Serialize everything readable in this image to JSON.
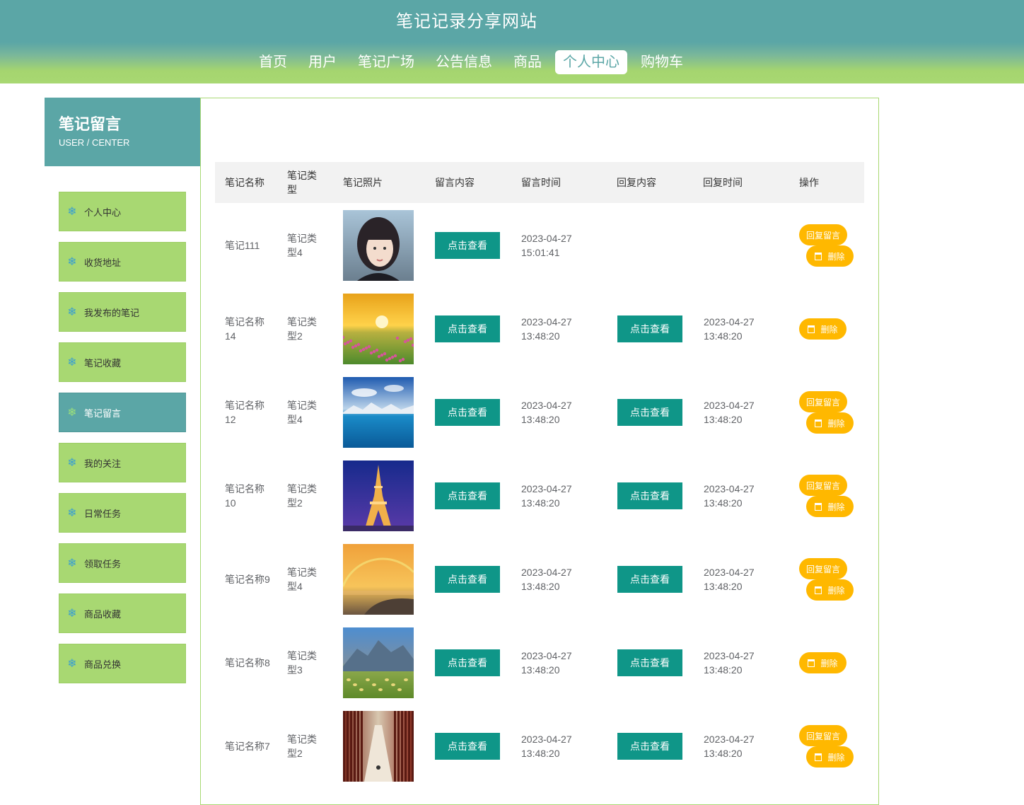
{
  "site": {
    "title": "笔记记录分享网站"
  },
  "nav": [
    {
      "label": "首页",
      "active": false
    },
    {
      "label": "用户",
      "active": false
    },
    {
      "label": "笔记广场",
      "active": false
    },
    {
      "label": "公告信息",
      "active": false
    },
    {
      "label": "商品",
      "active": false
    },
    {
      "label": "个人中心",
      "active": true
    },
    {
      "label": "购物车",
      "active": false
    }
  ],
  "sidebar": {
    "title": "笔记留言",
    "subtitle": "USER / CENTER",
    "icon": "snowflake-icon",
    "items": [
      {
        "label": "个人中心",
        "active": false
      },
      {
        "label": "收货地址",
        "active": false
      },
      {
        "label": "我发布的笔记",
        "active": false
      },
      {
        "label": "笔记收藏",
        "active": false
      },
      {
        "label": "笔记留言",
        "active": true
      },
      {
        "label": "我的关注",
        "active": false
      },
      {
        "label": "日常任务",
        "active": false
      },
      {
        "label": "领取任务",
        "active": false
      },
      {
        "label": "商品收藏",
        "active": false
      },
      {
        "label": "商品兑换",
        "active": false
      }
    ]
  },
  "table": {
    "headers": [
      "笔记名称",
      "笔记类型",
      "笔记照片",
      "留言内容",
      "留言时间",
      "回复内容",
      "回复时间",
      "操作"
    ],
    "view_label": "点击查看",
    "reply_label": "回复留言",
    "delete_label": "删除",
    "rows": [
      {
        "name": "笔记111",
        "type": "笔记类型4",
        "photo": "portrait",
        "msg_time": "2023-04-27 15:01:41",
        "has_reply": false,
        "reply_time": "",
        "can_reply": true
      },
      {
        "name": "笔记名称14",
        "type": "笔记类型2",
        "photo": "sunset-flowers",
        "msg_time": "2023-04-27 13:48:20",
        "has_reply": true,
        "reply_time": "2023-04-27 13:48:20",
        "can_reply": false
      },
      {
        "name": "笔记名称12",
        "type": "笔记类型4",
        "photo": "sea-mountains",
        "msg_time": "2023-04-27 13:48:20",
        "has_reply": true,
        "reply_time": "2023-04-27 13:48:20",
        "can_reply": true
      },
      {
        "name": "笔记名称10",
        "type": "笔记类型2",
        "photo": "eiffel-tower",
        "msg_time": "2023-04-27 13:48:20",
        "has_reply": true,
        "reply_time": "2023-04-27 13:48:20",
        "can_reply": true
      },
      {
        "name": "笔记名称9",
        "type": "笔记类型4",
        "photo": "rainbow-coast",
        "msg_time": "2023-04-27 13:48:20",
        "has_reply": true,
        "reply_time": "2023-04-27 13:48:20",
        "can_reply": true
      },
      {
        "name": "笔记名称8",
        "type": "笔记类型3",
        "photo": "mountain-meadow",
        "msg_time": "2023-04-27 13:48:20",
        "has_reply": true,
        "reply_time": "2023-04-27 13:48:20",
        "can_reply": false
      },
      {
        "name": "笔记名称7",
        "type": "笔记类型2",
        "photo": "corridor",
        "msg_time": "2023-04-27 13:48:20",
        "has_reply": true,
        "reply_time": "2023-04-27 13:48:20",
        "can_reply": true
      }
    ]
  },
  "colors": {
    "teal": "#5ba6a6",
    "green": "#a8d872",
    "button": "#0f9688",
    "action": "#ffb800"
  }
}
